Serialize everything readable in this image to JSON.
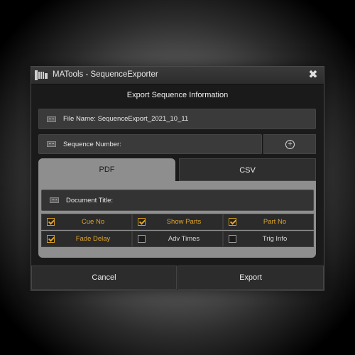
{
  "window": {
    "title": "MATools - SequenceExporter"
  },
  "header": {
    "section_title": "Export Sequence Information"
  },
  "fields": {
    "file_name": "File Name: SequenceExport_2021_10_11",
    "sequence_number": "Sequence Number:",
    "add_symbol": "+"
  },
  "tabs": [
    {
      "label": "PDF",
      "active": true
    },
    {
      "label": "CSV",
      "active": false
    }
  ],
  "pdf": {
    "document_title": "Document Title:",
    "options": [
      {
        "label": "Cue No",
        "checked": true
      },
      {
        "label": "Show Parts",
        "checked": true
      },
      {
        "label": "Part No",
        "checked": true
      },
      {
        "label": "Fade Delay",
        "checked": true
      },
      {
        "label": "Adv Times",
        "checked": false
      },
      {
        "label": "Trig Info",
        "checked": false
      }
    ]
  },
  "footer": {
    "cancel_label": "Cancel",
    "export_label": "Export"
  },
  "colors": {
    "accent": "#e0a52a",
    "tab_active": "#8e8e8e",
    "background": "#1a1a1a"
  },
  "icons": {
    "app": "ma-app-icon",
    "close": "close-icon",
    "keyboard": "keyboard-icon",
    "add": "add-circle-icon"
  }
}
